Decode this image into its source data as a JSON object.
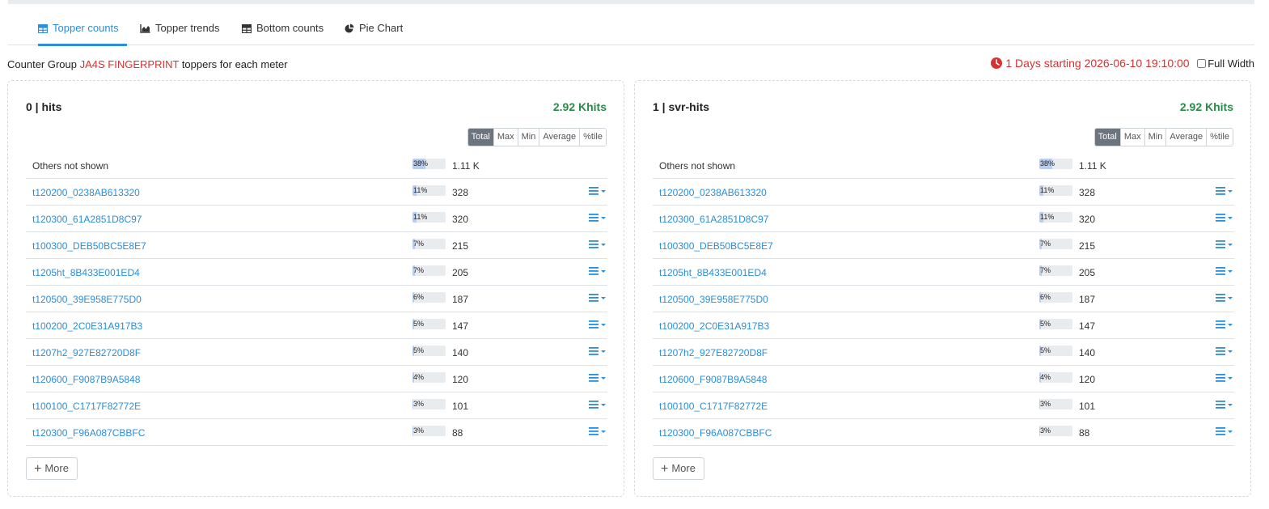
{
  "tabs": [
    {
      "label": "Topper counts",
      "icon": "table-icon",
      "active": true
    },
    {
      "label": "Topper trends",
      "icon": "area-chart-icon"
    },
    {
      "label": "Bottom counts",
      "icon": "table-icon"
    },
    {
      "label": "Pie Chart",
      "icon": "pie-chart-icon"
    }
  ],
  "subtitle": {
    "prefix": "Counter Group",
    "group": "JA4S FINGERPRINT",
    "suffix": "toppers for each meter"
  },
  "time": {
    "text": "1 Days starting 2026-06-10 19:10:00",
    "full_width_label": "Full Width",
    "full_width_checked": false
  },
  "colors": {
    "accent": "#2b8ed8",
    "red": "#d63232",
    "green": "#2a8a4a",
    "bar_fill": "#b8cdf0"
  },
  "stat_buttons": [
    "Total",
    "Max",
    "Min",
    "Average",
    "%tile"
  ],
  "active_stat": "Total",
  "more_label": "More",
  "panels": [
    {
      "title": "0 | hits",
      "total": "2.92 Khits",
      "rows": [
        {
          "key": "Others not shown",
          "pct": "38%",
          "frac": 0.38,
          "value": "1.11 K",
          "link": false
        },
        {
          "key": "t120200_0238AB613320",
          "pct": "11%",
          "frac": 0.11,
          "value": "328",
          "link": true
        },
        {
          "key": "t120300_61A2851D8C97",
          "pct": "11%",
          "frac": 0.11,
          "value": "320",
          "link": true
        },
        {
          "key": "t100300_DEB50BC5E8E7",
          "pct": "7%",
          "frac": 0.07,
          "value": "215",
          "link": true
        },
        {
          "key": "t1205ht_8B433E001ED4",
          "pct": "7%",
          "frac": 0.07,
          "value": "205",
          "link": true
        },
        {
          "key": "t120500_39E958E775D0",
          "pct": "6%",
          "frac": 0.06,
          "value": "187",
          "link": true
        },
        {
          "key": "t100200_2C0E31A917B3",
          "pct": "5%",
          "frac": 0.05,
          "value": "147",
          "link": true
        },
        {
          "key": "t1207h2_927E82720D8F",
          "pct": "5%",
          "frac": 0.05,
          "value": "140",
          "link": true
        },
        {
          "key": "t120600_F9087B9A5848",
          "pct": "4%",
          "frac": 0.04,
          "value": "120",
          "link": true
        },
        {
          "key": "t100100_C1717F82772E",
          "pct": "3%",
          "frac": 0.03,
          "value": "101",
          "link": true
        },
        {
          "key": "t120300_F96A087CBBFC",
          "pct": "3%",
          "frac": 0.03,
          "value": "88",
          "link": true
        }
      ]
    },
    {
      "title": "1 | svr-hits",
      "total": "2.92 Khits",
      "rows": [
        {
          "key": "Others not shown",
          "pct": "38%",
          "frac": 0.38,
          "value": "1.11 K",
          "link": false
        },
        {
          "key": "t120200_0238AB613320",
          "pct": "11%",
          "frac": 0.11,
          "value": "328",
          "link": true
        },
        {
          "key": "t120300_61A2851D8C97",
          "pct": "11%",
          "frac": 0.11,
          "value": "320",
          "link": true
        },
        {
          "key": "t100300_DEB50BC5E8E7",
          "pct": "7%",
          "frac": 0.07,
          "value": "215",
          "link": true
        },
        {
          "key": "t1205ht_8B433E001ED4",
          "pct": "7%",
          "frac": 0.07,
          "value": "205",
          "link": true
        },
        {
          "key": "t120500_39E958E775D0",
          "pct": "6%",
          "frac": 0.06,
          "value": "187",
          "link": true
        },
        {
          "key": "t100200_2C0E31A917B3",
          "pct": "5%",
          "frac": 0.05,
          "value": "147",
          "link": true
        },
        {
          "key": "t1207h2_927E82720D8F",
          "pct": "5%",
          "frac": 0.05,
          "value": "140",
          "link": true
        },
        {
          "key": "t120600_F9087B9A5848",
          "pct": "4%",
          "frac": 0.04,
          "value": "120",
          "link": true
        },
        {
          "key": "t100100_C1717F82772E",
          "pct": "3%",
          "frac": 0.03,
          "value": "101",
          "link": true
        },
        {
          "key": "t120300_F96A087CBBFC",
          "pct": "3%",
          "frac": 0.03,
          "value": "88",
          "link": true
        }
      ]
    }
  ]
}
